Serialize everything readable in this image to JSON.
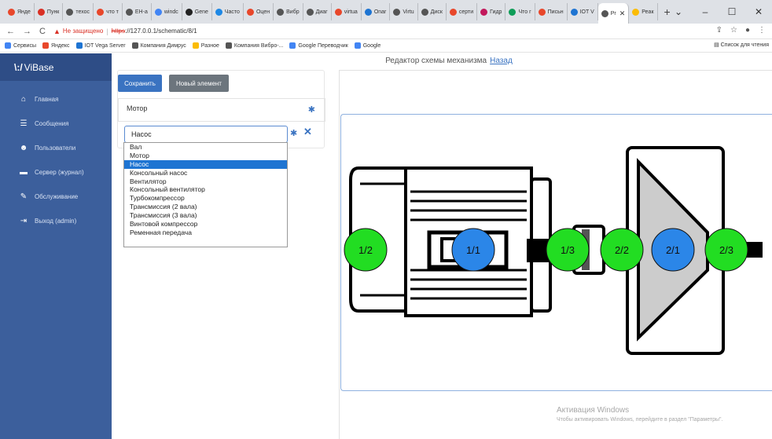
{
  "browser": {
    "tabs": [
      {
        "label": "Янде",
        "color": "#e8472b"
      },
      {
        "label": "Пунк",
        "color": "#d93025"
      },
      {
        "label": "техос",
        "color": "#555"
      },
      {
        "label": "что т",
        "color": "#e8472b"
      },
      {
        "label": "ЕН-а",
        "color": "#555"
      },
      {
        "label": "windc",
        "color": "#4285f4"
      },
      {
        "label": "Gene",
        "color": "#222"
      },
      {
        "label": "Часто",
        "color": "#1e88e5"
      },
      {
        "label": "Оцен",
        "color": "#e8472b"
      },
      {
        "label": "Вибр",
        "color": "#555"
      },
      {
        "label": "Диаг",
        "color": "#555"
      },
      {
        "label": "virtua",
        "color": "#e8472b"
      },
      {
        "label": "Onar",
        "color": "#1e74d2"
      },
      {
        "label": "Virtu",
        "color": "#555"
      },
      {
        "label": "Диск",
        "color": "#555"
      },
      {
        "label": "серти",
        "color": "#e8472b"
      },
      {
        "label": "Гидр",
        "color": "#c2185b"
      },
      {
        "label": "Что г",
        "color": "#0f9d58"
      },
      {
        "label": "Письн",
        "color": "#e8472b"
      },
      {
        "label": "IOT V",
        "color": "#1e74d2"
      },
      {
        "label": "Pr",
        "color": "#555",
        "active": true
      },
      {
        "label": "Реак",
        "color": "#fbbc05"
      }
    ],
    "new_tab": "+",
    "window_controls": [
      "⌄",
      "–",
      "☐",
      "✕"
    ],
    "insecure_label": "Не защищено",
    "url_https": "https",
    "url_rest": "://127.0.0.1/schematic/8/1",
    "bookmarks": [
      {
        "label": "Сервисы",
        "color": "#4285f4"
      },
      {
        "label": "Яндекс",
        "color": "#e8472b"
      },
      {
        "label": "IOT Vega Server",
        "color": "#1e74d2"
      },
      {
        "label": "Компания Димрус",
        "color": "#555"
      },
      {
        "label": "Разное",
        "color": "#fbbc05"
      },
      {
        "label": "Компания Вибро-...",
        "color": "#555"
      },
      {
        "label": "Google Переводчик",
        "color": "#4285f4"
      },
      {
        "label": "Google",
        "color": "#4285f4"
      }
    ],
    "reading_list": "Список для чтения"
  },
  "sidebar": {
    "brand": "ViBase",
    "items": [
      {
        "label": "Главная",
        "icon": "home-icon",
        "glyph": "⌂"
      },
      {
        "label": "Сообщения",
        "icon": "list-icon",
        "glyph": "☰"
      },
      {
        "label": "Пользователи",
        "icon": "users-icon",
        "glyph": "☻"
      },
      {
        "label": "Сервер (журнал)",
        "icon": "server-icon",
        "glyph": "▬"
      },
      {
        "label": "Обслуживание",
        "icon": "wrench-icon",
        "glyph": "✎"
      },
      {
        "label": "Выход (admin)",
        "icon": "logout-icon",
        "glyph": "⇥"
      }
    ]
  },
  "toolbar": {
    "save_label": "Сохранить",
    "new_element_label": "Новый элемент"
  },
  "elements": {
    "motor_label": "Мотор",
    "select_value": "Насос",
    "dropdown_options": [
      "Вал",
      "Мотор",
      "Насос",
      "Консольный насос",
      "Вентилятор",
      "Консольный вентилятор",
      "Турбокомпрессор",
      "Трансмиссия (2 вала)",
      "Трансмиссия (3 вала)",
      "Винтовой компрессор",
      "Ременная передача"
    ],
    "selected_index": 2
  },
  "editor": {
    "title": "Редактор схемы механизма",
    "back_link": "Назад"
  },
  "scheme": {
    "points": [
      {
        "label": "1/2",
        "color": "#22dd22"
      },
      {
        "label": "1/1",
        "color": "#2b86e8"
      },
      {
        "label": "1/3",
        "color": "#22dd22"
      },
      {
        "label": "2/2",
        "color": "#22dd22"
      },
      {
        "label": "2/1",
        "color": "#2b86e8"
      },
      {
        "label": "2/3",
        "color": "#22dd22"
      }
    ]
  },
  "watermark": {
    "line1": "Активация Windows",
    "line2": "Чтобы активировать Windows, перейдите в раздел \"Параметры\"."
  }
}
